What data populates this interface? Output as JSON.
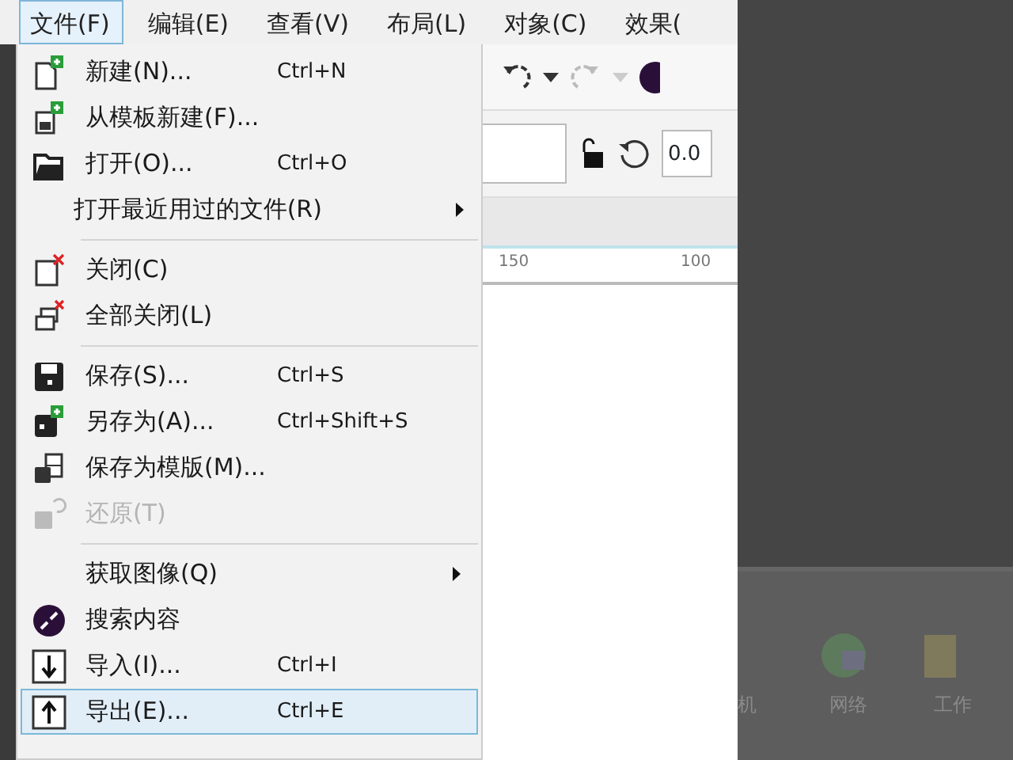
{
  "menu_bar": [
    {
      "label": "文件(F)",
      "selected": true
    },
    {
      "label": "编辑(E)",
      "selected": false
    },
    {
      "label": "查看(V)",
      "selected": false
    },
    {
      "label": "布局(L)",
      "selected": false
    },
    {
      "label": "对象(C)",
      "selected": false
    },
    {
      "label": "效果(",
      "selected": false
    }
  ],
  "property_bar": {
    "angle": "0.0"
  },
  "ruler": {
    "labels": [
      "150",
      "100"
    ]
  },
  "file_menu": [
    {
      "kind": "item",
      "label": "新建(N)...",
      "shortcut": "Ctrl+N",
      "disabled": false,
      "selected": false,
      "submenu": false
    },
    {
      "kind": "item",
      "label": "从模板新建(F)...",
      "disabled": false,
      "selected": false,
      "submenu": false
    },
    {
      "kind": "item",
      "label": "打开(O)...",
      "shortcut": "Ctrl+O",
      "disabled": false,
      "selected": false,
      "submenu": false
    },
    {
      "kind": "item",
      "label": "打开最近用过的文件(R)",
      "disabled": false,
      "selected": false,
      "submenu": true
    },
    {
      "kind": "separator"
    },
    {
      "kind": "item",
      "label": "关闭(C)",
      "disabled": false,
      "selected": false,
      "submenu": false
    },
    {
      "kind": "item",
      "label": "全部关闭(L)",
      "disabled": false,
      "selected": false,
      "submenu": false
    },
    {
      "kind": "separator"
    },
    {
      "kind": "item",
      "label": "保存(S)...",
      "shortcut": "Ctrl+S",
      "disabled": false,
      "selected": false,
      "submenu": false
    },
    {
      "kind": "item",
      "label": "另存为(A)...",
      "shortcut": "Ctrl+Shift+S",
      "disabled": false,
      "selected": false,
      "submenu": false
    },
    {
      "kind": "item",
      "label": "保存为模版(M)...",
      "disabled": false,
      "selected": false,
      "submenu": false
    },
    {
      "kind": "item",
      "label": "还原(T)",
      "disabled": true,
      "selected": false,
      "submenu": false
    },
    {
      "kind": "separator"
    },
    {
      "kind": "item",
      "label": "获取图像(Q)",
      "disabled": false,
      "selected": false,
      "submenu": true
    },
    {
      "kind": "item",
      "label": "搜索内容",
      "disabled": false,
      "selected": false,
      "submenu": false
    },
    {
      "kind": "item",
      "label": "导入(I)...",
      "shortcut": "Ctrl+I",
      "disabled": false,
      "selected": false,
      "submenu": false
    },
    {
      "kind": "item",
      "label": "导出(E)...",
      "shortcut": "Ctrl+E",
      "disabled": false,
      "selected": true,
      "submenu": false
    }
  ],
  "background_window": {
    "items": [
      "机",
      "网络",
      "工作"
    ]
  }
}
